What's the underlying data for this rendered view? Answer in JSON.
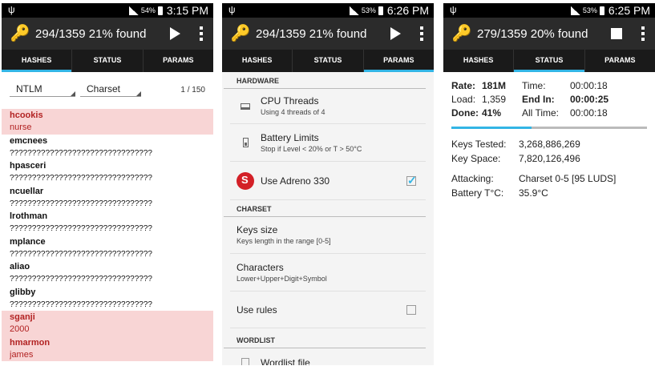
{
  "status_bars": [
    {
      "battery": "54%",
      "time": "3:15 PM"
    },
    {
      "battery": "53%",
      "time": "6:26 PM"
    },
    {
      "battery": "53%",
      "time": "6:25 PM"
    }
  ],
  "action_bars": [
    {
      "title": "294/1359 21% found",
      "action_icon": "play-icon"
    },
    {
      "title": "294/1359 21% found",
      "action_icon": "play-icon"
    },
    {
      "title": "279/1359 20% found",
      "action_icon": "stop-icon"
    }
  ],
  "tabs": [
    "HASHES",
    "STATUS",
    "PARAMS"
  ],
  "hashes": {
    "hash_type": "NTLM",
    "mode": "Charset",
    "pager": "1 / 150",
    "items": [
      {
        "name": "hcookis",
        "value": "nurse",
        "found": true
      },
      {
        "name": "emcnees",
        "value": "????????????????????????????????",
        "found": false
      },
      {
        "name": "hpasceri",
        "value": "????????????????????????????????",
        "found": false
      },
      {
        "name": "ncuellar",
        "value": "????????????????????????????????",
        "found": false
      },
      {
        "name": "lrothman",
        "value": "????????????????????????????????",
        "found": false
      },
      {
        "name": "mplance",
        "value": "????????????????????????????????",
        "found": false
      },
      {
        "name": "aliao",
        "value": "????????????????????????????????",
        "found": false
      },
      {
        "name": "glibby",
        "value": "????????????????????????????????",
        "found": false
      },
      {
        "name": "sganji",
        "value": "2000",
        "found": true
      },
      {
        "name": "hmarmon",
        "value": "james",
        "found": true
      }
    ]
  },
  "params": {
    "hardware_header": "HARDWARE",
    "cpu_title": "CPU Threads",
    "cpu_sub": "Using 4 threads of 4",
    "battery_title": "Battery Limits",
    "battery_sub": "Stop if Level < 20% or T > 50°C",
    "adreno_title": "Use Adreno 330",
    "adreno_checked": true,
    "charset_header": "CHARSET",
    "keysize_title": "Keys size",
    "keysize_sub": "Keys length in the range [0-5]",
    "characters_title": "Characters",
    "characters_sub": "Lower+Upper+Digit+Symbol",
    "rules_title": "Use rules",
    "rules_checked": false,
    "wordlist_header": "WORDLIST",
    "wordlist_title": "Wordlist file"
  },
  "status": {
    "rate_label": "Rate:",
    "rate": "181M",
    "time_label": "Time:",
    "time": "00:00:18",
    "load_label": "Load:",
    "load": "1,359",
    "endin_label": "End In:",
    "endin": "00:00:25",
    "done_label": "Done:",
    "done": "41%",
    "alltime_label": "All Time:",
    "alltime": "00:00:18",
    "progress": 0.41,
    "keys_tested_label": "Keys Tested:",
    "keys_tested": "3,268,886,269",
    "key_space_label": "Key Space:",
    "key_space": "7,820,126,496",
    "attacking_label": "Attacking:",
    "attacking": "Charset 0-5 [95 LUDS]",
    "battery_temp_label": "Battery T°C:",
    "battery_temp": "35.9°C"
  },
  "colors": {
    "accent": "#33b5e5",
    "found_bg": "#f8d5d5",
    "found_text": "#b22222",
    "actionbar": "#2b2b2b"
  }
}
